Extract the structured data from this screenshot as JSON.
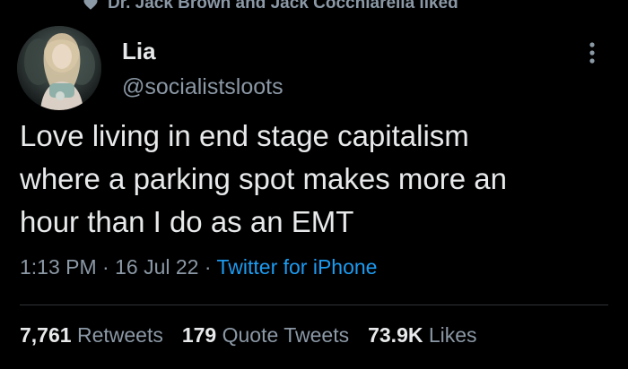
{
  "social_context": {
    "icon": "heart-icon",
    "text": "Dr. Jack Brown and Jack Cocchiarella liked"
  },
  "author": {
    "avatar": "avatar",
    "name": "Lia",
    "handle": "@socialistsloots"
  },
  "more_icon": "more-vertical-icon",
  "tweet": {
    "lines": [
      "Love living in end stage capitalism",
      "where a parking spot makes more an",
      "hour than I do as an EMT"
    ]
  },
  "meta": {
    "time": "1:13 PM",
    "date": "16 Jul 22",
    "separator": " · ",
    "source": "Twitter for iPhone"
  },
  "stats": {
    "retweets": {
      "count": "7,761",
      "label": "Retweets"
    },
    "quotes": {
      "count": "179",
      "label": "Quote Tweets"
    },
    "likes": {
      "count": "73.9K",
      "label": "Likes"
    }
  },
  "colors": {
    "background": "#000000",
    "text_primary": "#e7e9ea",
    "text_secondary": "#8b98a5",
    "link": "#1d9bf0",
    "divider": "#2f3336"
  }
}
